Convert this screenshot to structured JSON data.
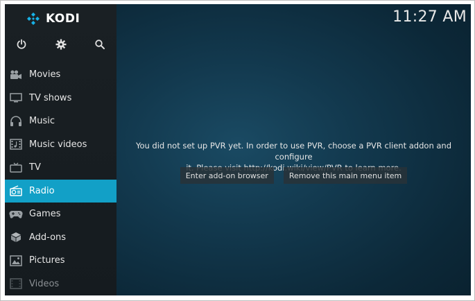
{
  "app": {
    "logo_text": "KODI",
    "brand_color": "#17b2e7"
  },
  "clock": "11:27 AM",
  "top_icons": [
    "power-icon",
    "gear-icon",
    "search-icon"
  ],
  "menu": {
    "items": [
      {
        "label": "Movies",
        "icon": "movie-camera-icon"
      },
      {
        "label": "TV shows",
        "icon": "monitor-icon"
      },
      {
        "label": "Music",
        "icon": "headphones-icon"
      },
      {
        "label": "Music videos",
        "icon": "film-music-icon"
      },
      {
        "label": "TV",
        "icon": "tv-icon"
      },
      {
        "label": "Radio",
        "icon": "radio-icon",
        "selected": true
      },
      {
        "label": "Games",
        "icon": "gamepad-icon"
      },
      {
        "label": "Add-ons",
        "icon": "box-icon"
      },
      {
        "label": "Pictures",
        "icon": "picture-icon"
      },
      {
        "label": "Videos",
        "icon": "film-icon"
      }
    ],
    "selected_color": "#12a0c7"
  },
  "message": {
    "line1": "You did not set up PVR yet. In order to use PVR, choose a PVR client addon and configure",
    "line2": "it. Please visit http://kodi.wiki/view/PVR to learn more."
  },
  "actions": {
    "enter_addon_browser": "Enter add-on browser",
    "remove_menu_item": "Remove this main menu item"
  }
}
